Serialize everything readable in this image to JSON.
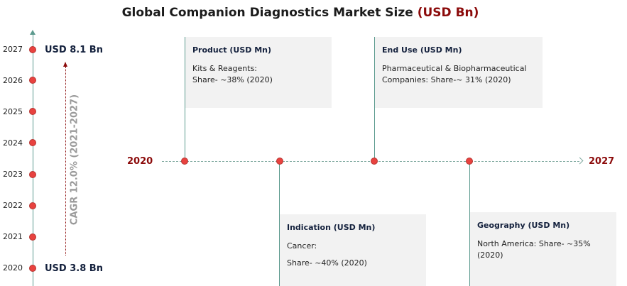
{
  "title": {
    "text": "Global Companion Diagnostics Market Size",
    "unit": "(USD Bn)"
  },
  "years": [
    "2027",
    "2026",
    "2025",
    "2024",
    "2023",
    "2022",
    "2021",
    "2020"
  ],
  "market": {
    "end_value": "USD 8.1 Bn",
    "start_value": "USD 3.8 Bn"
  },
  "cagr": {
    "label": "CAGR",
    "value": "12.0%",
    "period": "(2021-2027)"
  },
  "timeline": {
    "start_year": "2020",
    "end_year": "2027"
  },
  "cards": [
    {
      "title": "Product (USD Mn)",
      "lines": [
        "Kits & Reagents:",
        "Share- ~38% (2020)"
      ]
    },
    {
      "title": "End Use (USD Mn)",
      "lines": [
        "Pharmaceutical & Biopharmaceutical",
        "Companies: Share-~ 31% (2020)"
      ]
    },
    {
      "title": "Indication (USD Mn)",
      "lines": [
        "Cancer:",
        "",
        "Share- ~40% (2020)"
      ]
    },
    {
      "title": "Geography (USD Mn)",
      "lines": [
        "North America: Share- ~35%",
        "(2020)"
      ]
    }
  ],
  "colors": {
    "accent_red": "#8b0a0a",
    "dot": "#e8423f",
    "line": "#5c9a8e",
    "card_bg": "#f2f2f2"
  }
}
